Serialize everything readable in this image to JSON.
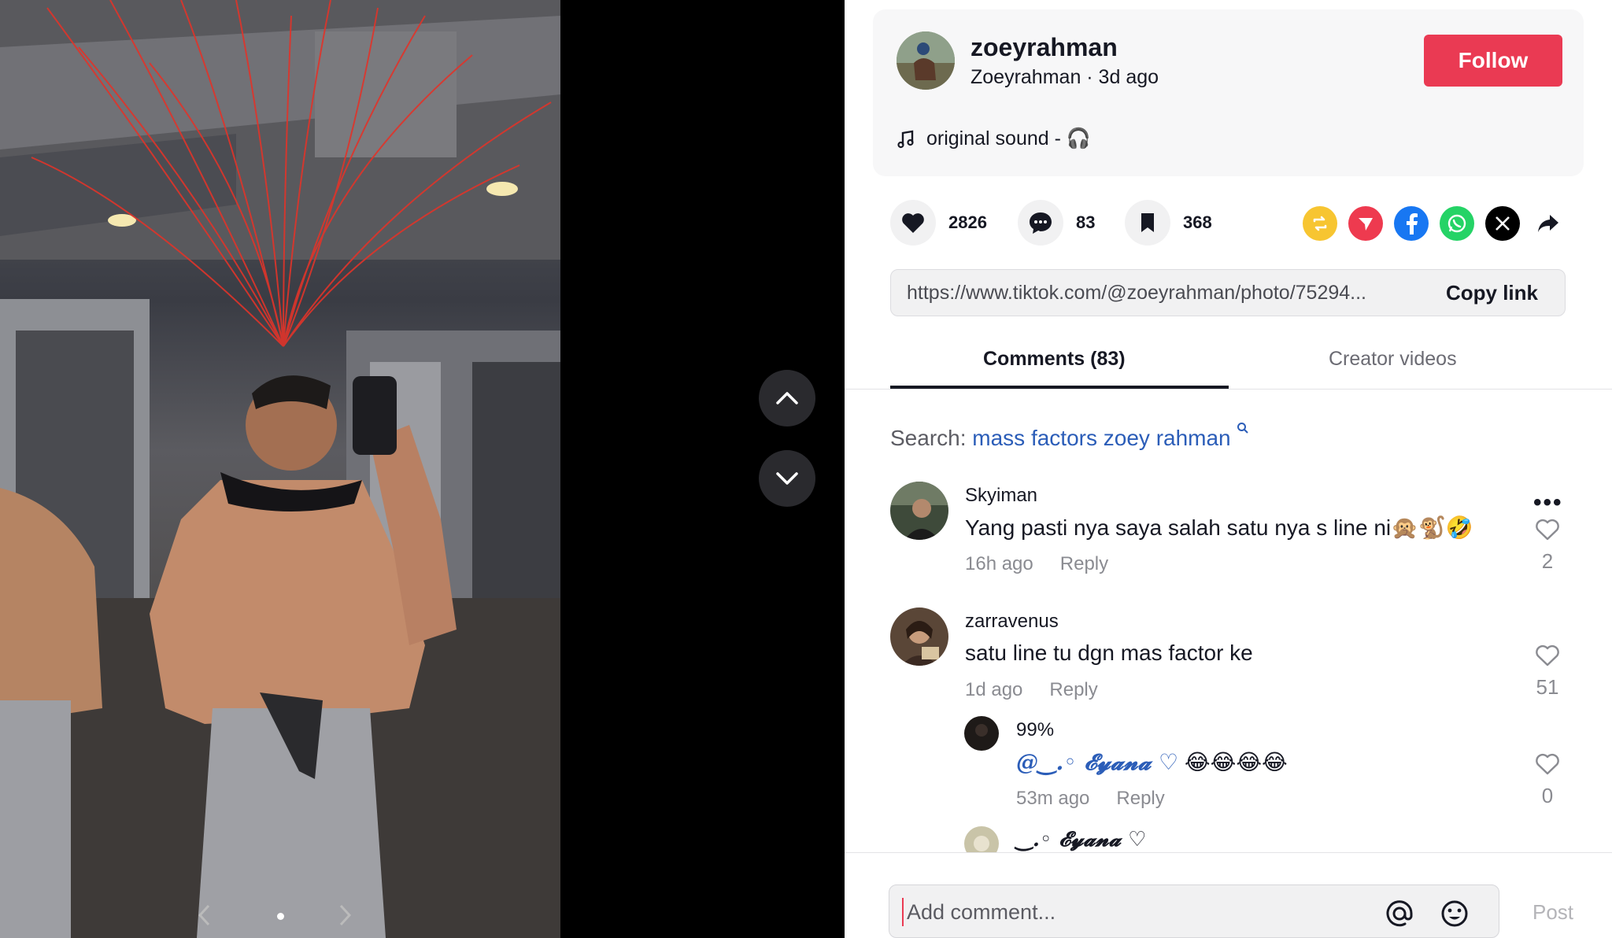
{
  "author": {
    "username": "zoeyrahman",
    "display_line": "Zoeyrahman · 3d ago",
    "follow_label": "Follow",
    "music": "original sound - 🎧"
  },
  "stats": {
    "likes": "2826",
    "comments": "83",
    "saves": "368"
  },
  "share_icons": [
    "repost-icon",
    "send-icon",
    "facebook-icon",
    "whatsapp-icon",
    "x-icon",
    "share-arrow-icon"
  ],
  "link": {
    "url": "https://www.tiktok.com/@zoeyrahman/photo/75294...",
    "copy_label": "Copy link"
  },
  "tabs": {
    "comments": "Comments (83)",
    "creator": "Creator videos"
  },
  "search": {
    "label": "Search:",
    "term": "mass factors zoey rahman"
  },
  "comments": [
    {
      "name": "Skyiman",
      "text": "Yang pasti nya saya salah satu nya s line ni🙊🐒🤣",
      "time": "16h ago",
      "reply": "Reply",
      "likes": "2"
    },
    {
      "name": "zarravenus",
      "text": "satu line tu dgn mas factor ke",
      "time": "1d ago",
      "reply": "Reply",
      "likes": "51"
    }
  ],
  "replies": [
    {
      "name": "99%",
      "mention": "@‿.◦ 𝓔𝔂𝓪𝓷𝓪 ♡",
      "text": " 😂😂😂😂",
      "time": "53m ago",
      "reply": "Reply",
      "likes": "0"
    },
    {
      "name": "‿.◦ 𝓔𝔂𝓪𝓷𝓪 ♡"
    }
  ],
  "input": {
    "placeholder": "Add comment...",
    "post_label": "Post"
  },
  "colors": {
    "accent": "#ea3a53",
    "link_blue": "#2b5db8",
    "panel_bg": "#f7f7f8"
  }
}
